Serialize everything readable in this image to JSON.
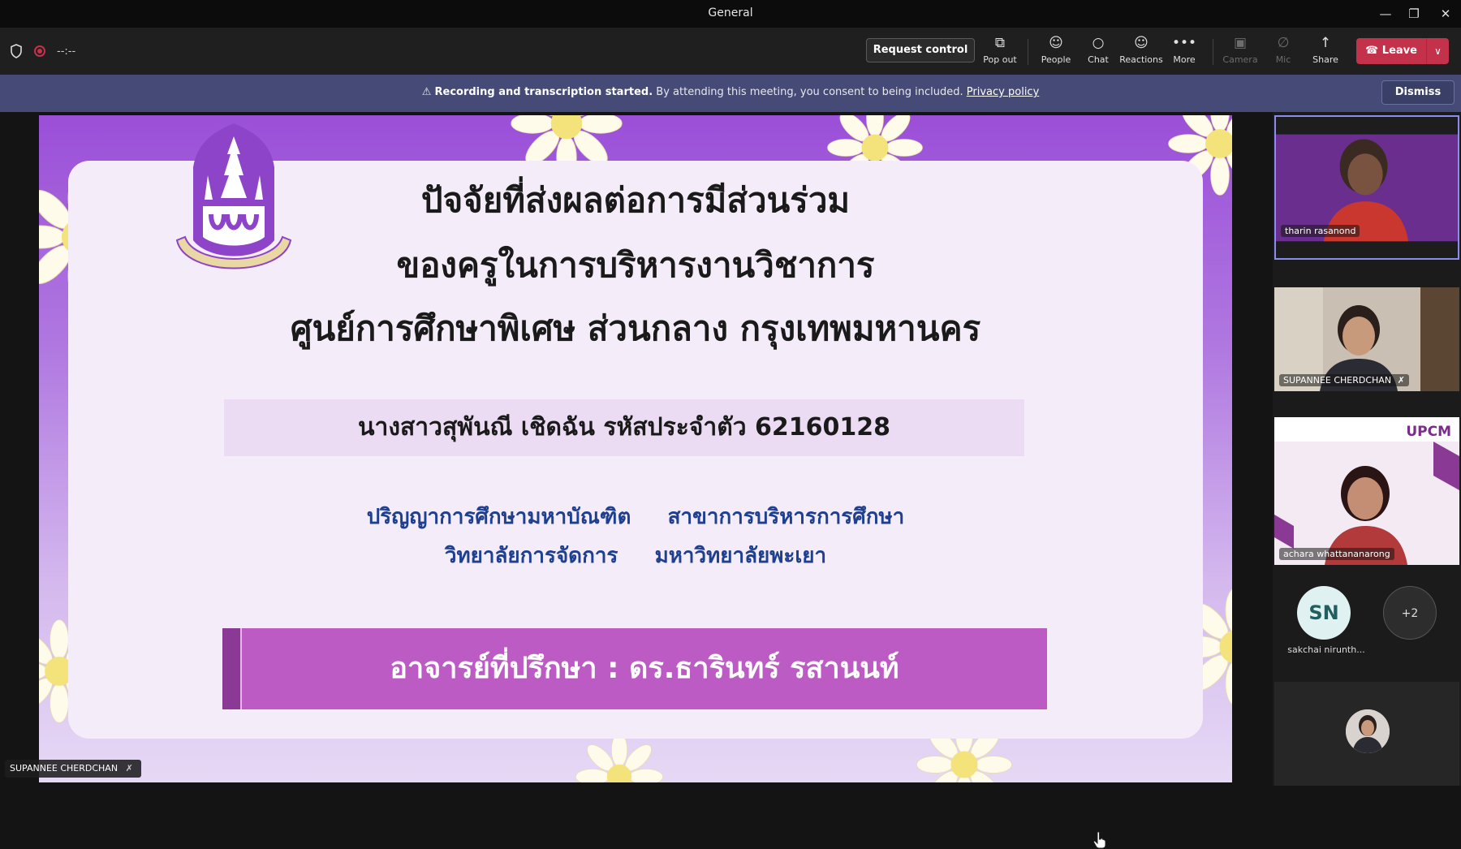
{
  "window": {
    "title": "General",
    "minimize": "—",
    "restore": "❐",
    "close": "✕"
  },
  "toolbar": {
    "timer": "--:--",
    "request_control": "Request control",
    "items": [
      {
        "label": "Pop out",
        "icon": "pop-out-icon",
        "glyph": "⧉"
      },
      {
        "label": "People",
        "icon": "people-icon",
        "glyph": "☺"
      },
      {
        "label": "Chat",
        "icon": "chat-icon",
        "glyph": "○"
      },
      {
        "label": "Reactions",
        "icon": "reactions-icon",
        "glyph": "☺"
      },
      {
        "label": "More",
        "icon": "more-icon",
        "glyph": "•••"
      },
      {
        "label": "Camera",
        "icon": "camera-off-icon",
        "glyph": "▣"
      },
      {
        "label": "Mic",
        "icon": "mic-off-icon",
        "glyph": "∅"
      },
      {
        "label": "Share",
        "icon": "share-icon",
        "glyph": "↑"
      }
    ],
    "leave": "Leave",
    "leave_caret": "∨"
  },
  "banner": {
    "bold": "Recording and transcription started.",
    "text": "By attending this meeting, you consent to being included.",
    "link": "Privacy policy",
    "dismiss": "Dismiss"
  },
  "slide": {
    "title_line1": "ปัจจัยที่ส่งผลต่อการมีส่วนร่วม",
    "title_line2": "ของครูในการบริหารงานวิชาการ",
    "title_line3": "ศูนย์การศึกษาพิเศษ ส่วนกลาง กรุงเทพมหานคร",
    "student": "นางสาวสุพันณี เชิดฉัน รหัสประจำตัว 62160128",
    "degree_line1": "ปริญญาการศึกษามหาบัณฑิต     สาขาการบริหารการศึกษา",
    "degree_line2": "วิทยาลัยการจัดการ     มหาวิทยาลัยพะเยา",
    "advisor": "อาจารย์ที่ปรึกษา  : ดร.ธารินทร์ รสานนท์"
  },
  "presenter": {
    "name": "SUPANNEE CHERDCHAN"
  },
  "participants": {
    "tile1": "tharin rasanond",
    "tile2": "SUPANNEE CHERDCHAN",
    "tile3": "achara whattananarong",
    "tile3_logo": "UPCM",
    "avatar_initials": "SN",
    "avatar_name": "sakchai nirunth...",
    "overflow": "+2"
  },
  "colors": {
    "accent": "#8b8cf0",
    "leave": "#c4314b",
    "banner": "#454a77"
  }
}
